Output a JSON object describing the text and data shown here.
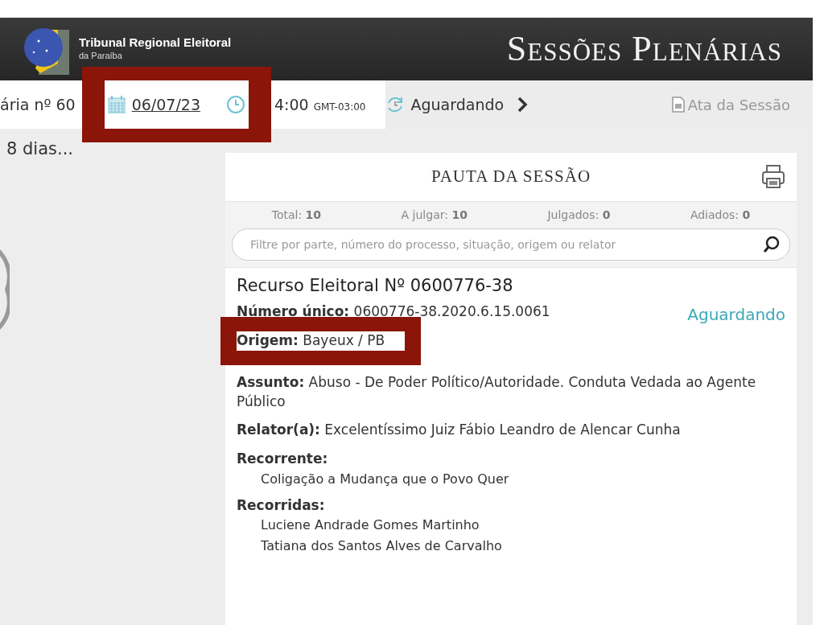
{
  "header": {
    "org_name": "Tribunal Regional Eleitoral",
    "org_sub": "da Paraíba",
    "title": "Sessões Plenárias"
  },
  "session_bar": {
    "session": "ária nº 60",
    "date": "06/07/23",
    "date_highlighted": true,
    "time": "4:00",
    "timezone": "GMT-03:00",
    "status": "Aguardando",
    "minutes_link": "Ata da Sessão"
  },
  "countdown": "8 dias...",
  "agenda": {
    "title": "PAUTA DA SESSÃO",
    "counts": [
      {
        "label": "Total:",
        "value": "10"
      },
      {
        "label": "A julgar:",
        "value": "10"
      },
      {
        "label": "Julgados:",
        "value": "0"
      },
      {
        "label": "Adiados:",
        "value": "0"
      }
    ],
    "search": {
      "placeholder": "Filtre por parte, número do processo, situação, origem ou relator"
    },
    "items": [
      {
        "title": "Recurso Eleitoral Nº 0600776-38",
        "status": "Aguardando",
        "fields": [
          {
            "kind": "inline",
            "label": "Número único:",
            "value": "0600776-38.2020.6.15.0061",
            "highlighted": false
          },
          {
            "kind": "inline",
            "label": "Origem:",
            "value": "Bayeux / PB",
            "highlighted": true
          },
          {
            "kind": "inline",
            "label": "Assunto:",
            "value": "Abuso - De Poder Político/Autoridade. Conduta Vedada ao Agente Público",
            "highlighted": false
          },
          {
            "kind": "inline",
            "label": "Relator(a):",
            "value": "Excelentíssimo Juiz Fábio Leandro de Alencar Cunha",
            "highlighted": false
          },
          {
            "kind": "list",
            "label": "Recorrente:",
            "values": [
              "Coligação a Mudança que o Povo Quer"
            ],
            "highlighted": false
          },
          {
            "kind": "list",
            "label": "Recorridas:",
            "values": [
              "Luciene Andrade Gomes Martinho",
              "Tatiana dos Santos Alves de Carvalho"
            ],
            "highlighted": false
          }
        ]
      }
    ]
  }
}
